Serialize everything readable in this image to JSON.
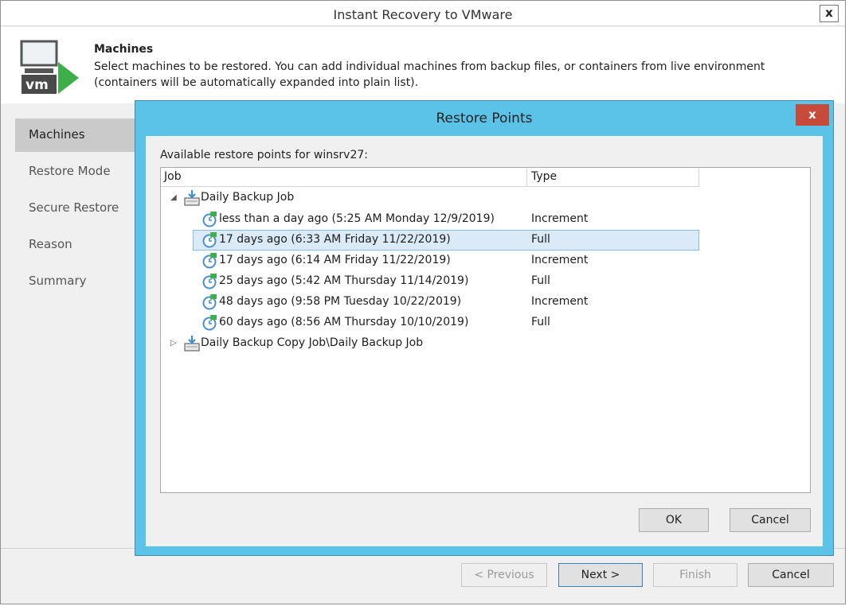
{
  "window": {
    "title": "Instant Recovery to VMware",
    "close_label": "x"
  },
  "header": {
    "title": "Machines",
    "description": "Select machines to be restored. You can add individual machines from backup files, or containers from live environment (containers will be automatically expanded into plain list).",
    "icon_text": "vm"
  },
  "sidebar": {
    "items": [
      {
        "label": "Machines"
      },
      {
        "label": "Restore Mode"
      },
      {
        "label": "Secure Restore"
      },
      {
        "label": "Reason"
      },
      {
        "label": "Summary"
      }
    ]
  },
  "footer": {
    "previous": "< Previous",
    "next": "Next >",
    "finish": "Finish",
    "cancel": "Cancel"
  },
  "dialog": {
    "title": "Restore Points",
    "close_label": "x",
    "label": "Available restore points for winsrv27:",
    "columns": {
      "job": "Job",
      "type": "Type"
    },
    "jobs": [
      {
        "name": "Daily Backup Job",
        "expanded": true
      },
      {
        "name": "Daily Backup Copy Job\\Daily Backup Job",
        "expanded": false
      }
    ],
    "points": [
      {
        "label": "less than a day ago (5:25 AM Monday 12/9/2019)",
        "type": "Increment"
      },
      {
        "label": "17 days ago (6:33 AM Friday 11/22/2019)",
        "type": "Full"
      },
      {
        "label": "17 days ago (6:14 AM Friday 11/22/2019)",
        "type": "Increment"
      },
      {
        "label": "25 days ago (5:42 AM Thursday 11/14/2019)",
        "type": "Full"
      },
      {
        "label": "48 days ago (9:58 PM Tuesday 10/22/2019)",
        "type": "Increment"
      },
      {
        "label": "60 days ago (8:56 AM Thursday 10/10/2019)",
        "type": "Full"
      }
    ],
    "ok": "OK",
    "cancel": "Cancel"
  },
  "colors": {
    "dialog_frame": "#5bc3e8",
    "close_red": "#c84a3a",
    "selection": "#dbeaf7",
    "vm_green": "#3dae49"
  }
}
